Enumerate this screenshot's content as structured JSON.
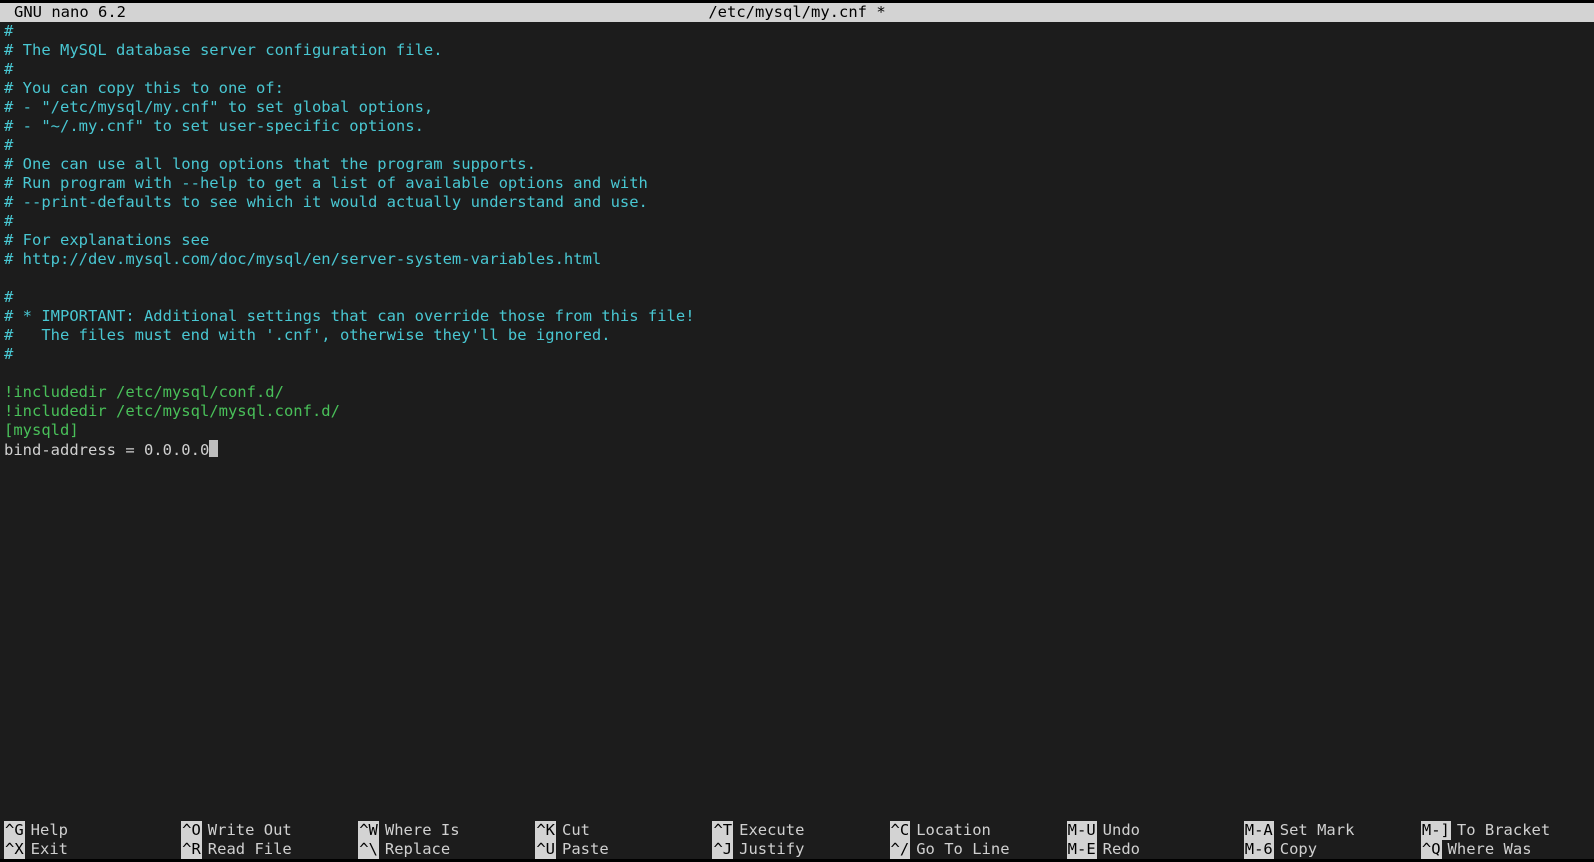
{
  "titlebar": {
    "app": "GNU nano 6.2",
    "file": "/etc/mysql/my.cnf *"
  },
  "file": {
    "lines": [
      {
        "cls": "comment",
        "text": "#"
      },
      {
        "cls": "comment",
        "text": "# The MySQL database server configuration file."
      },
      {
        "cls": "comment",
        "text": "#"
      },
      {
        "cls": "comment",
        "text": "# You can copy this to one of:"
      },
      {
        "cls": "comment",
        "text": "# - \"/etc/mysql/my.cnf\" to set global options,"
      },
      {
        "cls": "comment",
        "text": "# - \"~/.my.cnf\" to set user-specific options."
      },
      {
        "cls": "comment",
        "text": "#"
      },
      {
        "cls": "comment",
        "text": "# One can use all long options that the program supports."
      },
      {
        "cls": "comment",
        "text": "# Run program with --help to get a list of available options and with"
      },
      {
        "cls": "comment",
        "text": "# --print-defaults to see which it would actually understand and use."
      },
      {
        "cls": "comment",
        "text": "#"
      },
      {
        "cls": "comment",
        "text": "# For explanations see"
      },
      {
        "cls": "comment",
        "text": "# http://dev.mysql.com/doc/mysql/en/server-system-variables.html"
      },
      {
        "cls": "plain",
        "text": ""
      },
      {
        "cls": "comment",
        "text": "#"
      },
      {
        "cls": "comment",
        "text": "# * IMPORTANT: Additional settings that can override those from this file!"
      },
      {
        "cls": "comment",
        "text": "#   The files must end with '.cnf', otherwise they'll be ignored."
      },
      {
        "cls": "comment",
        "text": "#"
      },
      {
        "cls": "plain",
        "text": ""
      },
      {
        "cls": "directive",
        "text": "!includedir /etc/mysql/conf.d/"
      },
      {
        "cls": "directive",
        "text": "!includedir /etc/mysql/mysql.conf.d/"
      },
      {
        "cls": "section",
        "text": "[mysqld]"
      },
      {
        "cls": "plain",
        "text": "bind-address = 0.0.0.0",
        "cursor": true
      }
    ]
  },
  "shortcuts": {
    "row1": [
      {
        "key": "^G",
        "label": "Help"
      },
      {
        "key": "^O",
        "label": "Write Out"
      },
      {
        "key": "^W",
        "label": "Where Is"
      },
      {
        "key": "^K",
        "label": "Cut"
      },
      {
        "key": "^T",
        "label": "Execute"
      },
      {
        "key": "^C",
        "label": "Location"
      },
      {
        "key": "M-U",
        "label": "Undo"
      },
      {
        "key": "M-A",
        "label": "Set Mark"
      },
      {
        "key": "M-]",
        "label": "To Bracket"
      }
    ],
    "row2": [
      {
        "key": "^X",
        "label": "Exit"
      },
      {
        "key": "^R",
        "label": "Read File"
      },
      {
        "key": "^\\",
        "label": "Replace"
      },
      {
        "key": "^U",
        "label": "Paste"
      },
      {
        "key": "^J",
        "label": "Justify"
      },
      {
        "key": "^/",
        "label": "Go To Line"
      },
      {
        "key": "M-E",
        "label": "Redo"
      },
      {
        "key": "M-6",
        "label": "Copy"
      },
      {
        "key": "^Q",
        "label": "Where Was"
      }
    ]
  }
}
